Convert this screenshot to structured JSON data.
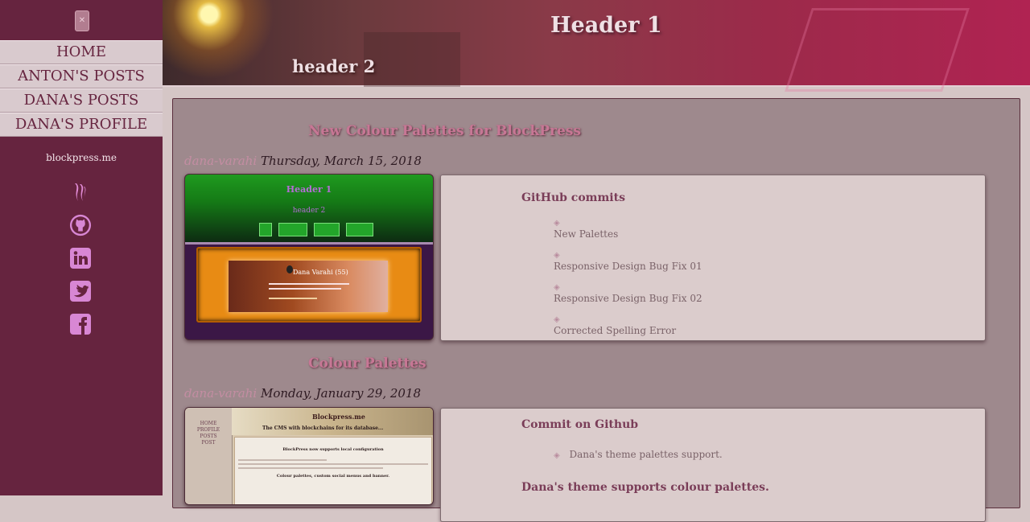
{
  "sidebar": {
    "logo_glyph": "✕",
    "nav": [
      {
        "label": "HOME"
      },
      {
        "label": "ANTON'S POSTS"
      },
      {
        "label": "DANA'S POSTS"
      },
      {
        "label": "DANA'S PROFILE"
      }
    ],
    "site_link": "blockpress.me",
    "social": [
      {
        "icon": "steem-icon",
        "color": "#e08ad4"
      },
      {
        "icon": "github-icon",
        "color": "#d887d4"
      },
      {
        "icon": "linkedin-icon",
        "color": "#d887d4"
      },
      {
        "icon": "twitter-icon",
        "color": "#d887d4"
      },
      {
        "icon": "facebook-icon",
        "color": "#d887d4"
      }
    ]
  },
  "header": {
    "h1": "Header 1",
    "h2": "header 2"
  },
  "posts": [
    {
      "title": "New Colour Palettes for BlockPress",
      "author": "dana-varahi",
      "date": "Thursday, March 15, 2018",
      "card_title": "GitHub commits",
      "bullet": "◈",
      "commits": [
        "New Palettes",
        "Responsive Design Bug Fix 01",
        "Responsive Design Bug Fix 02",
        "Corrected Spelling Error"
      ],
      "thumb": {
        "h1": "Header 1",
        "h2": "header 2",
        "name": "Dana Varahi (55)"
      }
    },
    {
      "title": "Colour Palettes",
      "author": "dana-varahi",
      "date": "Monday, January 29, 2018",
      "card_title": "Commit on Github",
      "bullet": "◈",
      "commit": "Dana's theme palettes support.",
      "card_title2": "Dana's theme supports colour palettes.",
      "thumb": {
        "nav": [
          "HOME",
          "PROFILE",
          "POSTS",
          "POST"
        ],
        "title": "Blockpress.me",
        "subtitle": "The CMS with blockchains for its database...",
        "headline": "BlockPress now supports local configuration",
        "headline2": "Colour palettes, custom social menus and banner."
      }
    }
  ],
  "colors": {
    "sidebar_bg": "#66243f",
    "nav_bg": "#d9cace",
    "main_bg": "#9e898d",
    "card_bg": "#dbcccc",
    "title_pink": "#c77795"
  }
}
